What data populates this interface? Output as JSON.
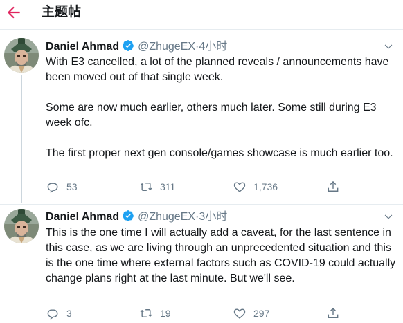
{
  "header": {
    "title": "主题帖",
    "back_icon": "arrow-left-icon",
    "accent": "#e0245e"
  },
  "tweets": [
    {
      "display_name": "Daniel Ahmad",
      "verified": true,
      "handle": "@ZhugeEX",
      "separator": "·",
      "time": "4小时",
      "paragraphs": [
        "With E3 cancelled, a lot of the planned reveals / announcements have been moved out of that single week.",
        "Some are now much earlier, others much later. Some still during E3 week ofc.",
        "The first proper next gen console/games showcase is much earlier too."
      ],
      "replies": "53",
      "retweets": "311",
      "likes": "1,736"
    },
    {
      "display_name": "Daniel Ahmad",
      "verified": true,
      "handle": "@ZhugeEX",
      "separator": "·",
      "time": "3小时",
      "paragraphs": [
        "This is the one time I will actually add a caveat, for the last sentence in this case, as we are living through an unprecedented situation and this is the one time where external factors such as COVID-19 could actually change plans right at the last minute. But we'll see."
      ],
      "replies": "3",
      "retweets": "19",
      "likes": "297"
    }
  ],
  "colors": {
    "verified": "#1da1f2",
    "muted": "#657786",
    "text": "#14171a"
  }
}
